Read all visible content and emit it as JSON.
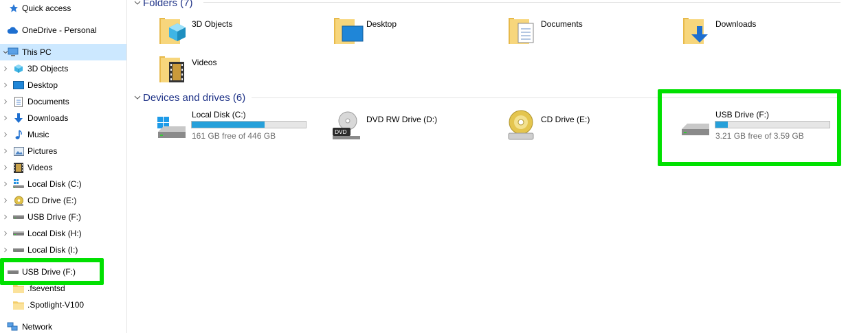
{
  "nav": {
    "items": [
      {
        "label": "Quick access",
        "icon": "star-icon"
      },
      {
        "label": "OneDrive - Personal",
        "icon": "cloud-icon"
      },
      {
        "label": "This PC",
        "icon": "computer-icon"
      },
      {
        "label": "3D Objects",
        "icon": "cube-icon"
      },
      {
        "label": "Desktop",
        "icon": "desktop-icon"
      },
      {
        "label": "Documents",
        "icon": "document-icon"
      },
      {
        "label": "Downloads",
        "icon": "download-arrow-icon"
      },
      {
        "label": "Music",
        "icon": "music-note-icon"
      },
      {
        "label": "Pictures",
        "icon": "picture-icon"
      },
      {
        "label": "Videos",
        "icon": "film-icon"
      },
      {
        "label": "Local Disk (C:)",
        "icon": "windows-drive-icon"
      },
      {
        "label": "CD Drive (E:)",
        "icon": "cd-icon"
      },
      {
        "label": "USB Drive (F:)",
        "icon": "drive-icon"
      },
      {
        "label": "Local Disk (H:)",
        "icon": "drive-icon"
      },
      {
        "label": "Local Disk (I:)",
        "icon": "drive-icon"
      },
      {
        "label": "USB Drive (F:)",
        "icon": "drive-icon"
      },
      {
        "label": ".fseventsd",
        "icon": "folder-icon"
      },
      {
        "label": ".Spotlight-V100",
        "icon": "folder-icon"
      },
      {
        "label": "Network",
        "icon": "network-icon"
      }
    ]
  },
  "folders_group": {
    "title": "Folders (7)",
    "items": [
      {
        "label": "3D Objects",
        "icon": "3d-objects-folder-icon"
      },
      {
        "label": "Desktop",
        "icon": "desktop-folder-icon"
      },
      {
        "label": "Documents",
        "icon": "documents-folder-icon"
      },
      {
        "label": "Downloads",
        "icon": "downloads-folder-icon"
      },
      {
        "label": "Videos",
        "icon": "videos-folder-icon"
      }
    ]
  },
  "drives_group": {
    "title": "Devices and drives (6)",
    "items": [
      {
        "label": "Local Disk (C:)",
        "free_text": "161 GB free of 446 GB",
        "used_fraction": 0.639,
        "icon": "windows-drive-icon"
      },
      {
        "label": "DVD RW Drive (D:)",
        "icon": "dvd-drive-icon"
      },
      {
        "label": "CD Drive (E:)",
        "icon": "cd-drive-icon"
      },
      {
        "label": "USB Drive (F:)",
        "free_text": "3.21 GB free of 3.59 GB",
        "used_fraction": 0.106,
        "icon": "usb-drive-icon"
      }
    ]
  },
  "colors": {
    "highlight": "#00e000",
    "selected_row": "#cce8ff",
    "group_title": "#1e3287",
    "usage_bar": "#26a0da"
  }
}
